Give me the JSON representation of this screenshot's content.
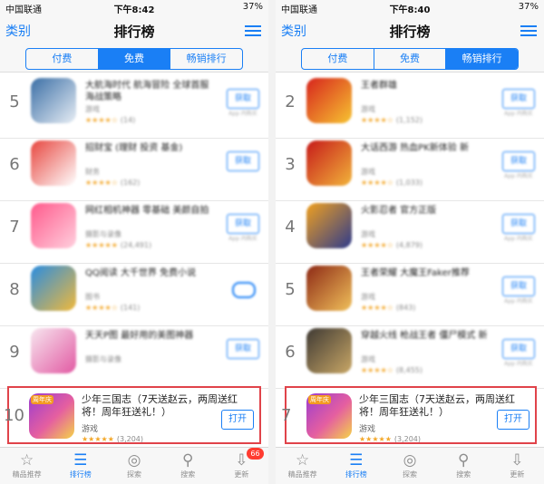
{
  "status": {
    "carrier": "中国联通",
    "battery": "37%"
  },
  "panels": [
    {
      "time": "下午8:42",
      "nav": {
        "category": "类别",
        "title": "排行榜"
      },
      "segments": [
        "付费",
        "免费",
        "畅销排行"
      ],
      "active_segment": 1,
      "rows": [
        {
          "rank": "5",
          "name": "大航海时代 航海冒险 全球首服海战策略",
          "category": "游戏",
          "rating": "★★★★☆",
          "count": "(14)",
          "button": "获取",
          "sub": "App 内购买",
          "icon_color": "#3b6fa6",
          "icon_color2": "#e8eef5"
        },
        {
          "rank": "6",
          "name": "招财宝 (理财 投资 基金)",
          "category": "财务",
          "rating": "★★★★☆",
          "count": "(162)",
          "button": "获取",
          "sub": "",
          "icon_color": "#e7463f",
          "icon_color2": "#ffffff"
        },
        {
          "rank": "7",
          "name": "网红相机神器 零基础 美颜自拍",
          "category": "摄影与录像",
          "rating": "★★★★★",
          "count": "(24,491)",
          "button": "获取",
          "sub": "App 内购买",
          "icon_color": "#ff5a8c",
          "icon_color2": "#ffd0de"
        },
        {
          "rank": "8",
          "name": "QQ阅读 大千世界 免费小说",
          "category": "图书",
          "rating": "★★★★☆",
          "count": "(141)",
          "button": "",
          "sub": "",
          "icon_color": "#2a8de0",
          "icon_color2": "#f1b93b"
        },
        {
          "rank": "9",
          "name": "天天P图 最好用的美图神器",
          "category": "摄影与录像",
          "rating": "",
          "count": "",
          "button": "获取",
          "sub": "",
          "icon_color": "#f7e6ef",
          "icon_color2": "#e25aa3"
        }
      ],
      "highlight": {
        "rank": "10",
        "name": "少年三国志（7天送赵云，两周送红将！周年狂送礼！）",
        "category": "游戏",
        "rating": "★★★★★",
        "count": "(3,204)",
        "button": "打开",
        "tag": "周年庆"
      }
    },
    {
      "time": "下午8:40",
      "nav": {
        "category": "类别",
        "title": "排行榜"
      },
      "segments": [
        "付费",
        "免费",
        "畅销排行"
      ],
      "active_segment": 2,
      "rows": [
        {
          "rank": "2",
          "name": "王者群雄",
          "category": "游戏",
          "rating": "★★★★☆",
          "count": "(1,152)",
          "button": "获取",
          "sub": "App 内购买",
          "icon_color": "#d7241d",
          "icon_color2": "#f7c431"
        },
        {
          "rank": "3",
          "name": "大话西游 热血PK新体验 新",
          "category": "游戏",
          "rating": "★★★★☆",
          "count": "(1,033)",
          "button": "获取",
          "sub": "App 内购买",
          "icon_color": "#c61a1a",
          "icon_color2": "#f2b43a"
        },
        {
          "rank": "4",
          "name": "火影忍者 官方正版",
          "category": "游戏",
          "rating": "★★★★☆",
          "count": "(4,879)",
          "button": "获取",
          "sub": "App 内购买",
          "icon_color": "#f0a020",
          "icon_color2": "#2e3b8c"
        },
        {
          "rank": "5",
          "name": "王者荣耀 大魔王Faker推荐",
          "category": "游戏",
          "rating": "★★★★☆",
          "count": "(843)",
          "button": "获取",
          "sub": "App 内购买",
          "icon_color": "#8e2a16",
          "icon_color2": "#f0c05a"
        },
        {
          "rank": "6",
          "name": "穿越火线 枪战王者 僵尸模式 新",
          "category": "游戏",
          "rating": "★★★★☆",
          "count": "(8,455)",
          "button": "获取",
          "sub": "App 内购买",
          "icon_color": "#3f3a34",
          "icon_color2": "#c9a766"
        }
      ],
      "highlight": {
        "rank": "7",
        "name": "少年三国志（7天送赵云，两周送红将！周年狂送礼！）",
        "category": "游戏",
        "rating": "★★★★★",
        "count": "(3,204)",
        "button": "打开",
        "tag": "周年庆"
      }
    }
  ],
  "tabbar": [
    {
      "label": "精品推荐",
      "icon": "star-icon",
      "glyph": "☆"
    },
    {
      "label": "排行榜",
      "icon": "list-icon",
      "glyph": "☰"
    },
    {
      "label": "探索",
      "icon": "compass-icon",
      "glyph": "◎"
    },
    {
      "label": "搜索",
      "icon": "search-icon",
      "glyph": "⚲"
    },
    {
      "label": "更新",
      "icon": "update-icon",
      "glyph": "⇩",
      "badge": "66"
    }
  ],
  "colors": {
    "accent": "#1a7ff5",
    "highlight_border": "#e0434a",
    "stars": "#f3a82b"
  }
}
